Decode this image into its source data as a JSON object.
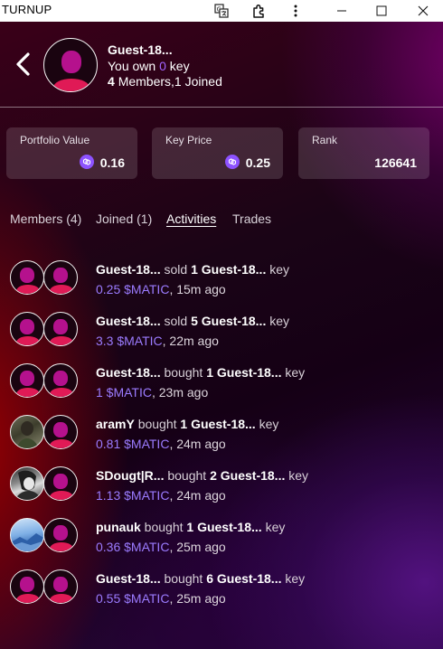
{
  "window": {
    "title": "TURNUP"
  },
  "header": {
    "name": "Guest-18...",
    "own_prefix": "You own",
    "own_count": "0",
    "own_suffix": "key",
    "members_count": "4",
    "members_text": "Members,",
    "joined_count": "1",
    "joined_text": "Joined"
  },
  "stats": [
    {
      "label": "Portfolio Value",
      "value": "0.16"
    },
    {
      "label": "Key Price",
      "value": "0.25"
    },
    {
      "label": "Rank",
      "value": "126641"
    }
  ],
  "tabs": [
    {
      "label": "Members (4)"
    },
    {
      "label": "Joined (1)"
    },
    {
      "label": "Activities"
    },
    {
      "label": "Trades"
    }
  ],
  "activities": [
    {
      "trader": "Guest-18...",
      "action": "sold",
      "qty": "1",
      "subject": "Guest-18...",
      "unit": "key",
      "amount": "0.25 $MATIC",
      "time": ", 15m ago",
      "avatar": "default"
    },
    {
      "trader": "Guest-18...",
      "action": "sold",
      "qty": "5",
      "subject": "Guest-18...",
      "unit": "key",
      "amount": "3.3 $MATIC",
      "time": ", 22m ago",
      "avatar": "default"
    },
    {
      "trader": "Guest-18...",
      "action": "bought",
      "qty": "1",
      "subject": "Guest-18...",
      "unit": "key",
      "amount": "1 $MATIC",
      "time": ", 23m ago",
      "avatar": "default"
    },
    {
      "trader": "aramY",
      "action": "bought",
      "qty": "1",
      "subject": "Guest-18...",
      "unit": "key",
      "amount": "0.81 $MATIC",
      "time": ", 24m ago",
      "avatar": "photo"
    },
    {
      "trader": "SDougt|R...",
      "action": "bought",
      "qty": "2",
      "subject": "Guest-18...",
      "unit": "key",
      "amount": "1.13 $MATIC",
      "time": ", 24m ago",
      "avatar": "photo"
    },
    {
      "trader": "punauk",
      "action": "bought",
      "qty": "1",
      "subject": "Guest-18...",
      "unit": "key",
      "amount": "0.36 $MATIC",
      "time": ", 25m ago",
      "avatar": "photo"
    },
    {
      "trader": "Guest-18...",
      "action": "bought",
      "qty": "6",
      "subject": "Guest-18...",
      "unit": "key",
      "amount": "0.55 $MATIC",
      "time": ", 25m ago",
      "avatar": "default"
    }
  ],
  "colors": {
    "accent_purple": "#9b7bff",
    "avatar_head": "#b5118d",
    "avatar_body": "#e01a56",
    "coin": "#8d52ff"
  },
  "icons": [
    "translate-icon",
    "extension-icon",
    "more-vertical-icon",
    "minimize-icon",
    "maximize-icon",
    "close-icon",
    "back-chevron-icon",
    "polygon-coin-icon"
  ]
}
